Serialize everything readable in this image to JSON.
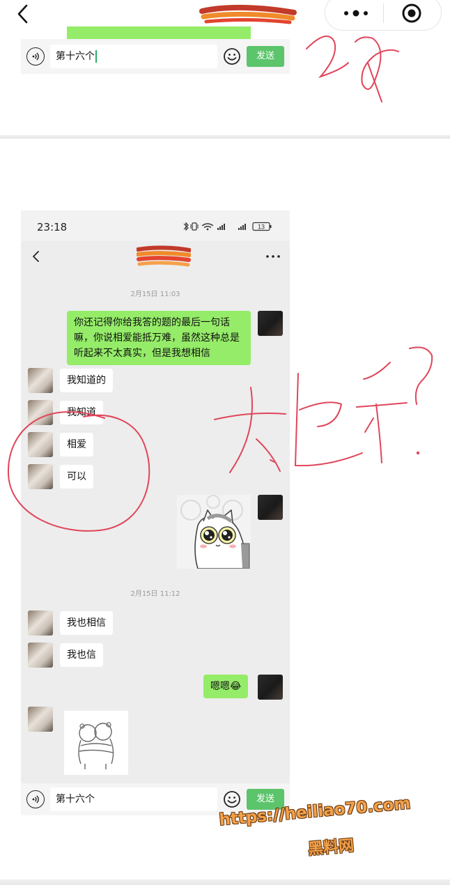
{
  "top_input": {
    "text": "第十六个",
    "send_label": "发送"
  },
  "phone": {
    "status_time": "23:18",
    "battery": "13",
    "messages": [
      {
        "type": "timestamp",
        "text": "2月15日 11:03"
      },
      {
        "type": "text",
        "side": "me",
        "text": "你还记得你给我答的题的最后一句话嘛，你说相爱能抵万难，虽然这种总是听起来不太真实，但是我想相信"
      },
      {
        "type": "text",
        "side": "other",
        "text": "我知道的"
      },
      {
        "type": "text",
        "side": "other",
        "text": "我知道"
      },
      {
        "type": "text",
        "side": "other",
        "text": "相爱"
      },
      {
        "type": "text",
        "side": "other",
        "text": "可以"
      },
      {
        "type": "sticker",
        "side": "me",
        "sticker": "crying-cat-sticker"
      },
      {
        "type": "timestamp",
        "text": "2月15日 11:12"
      },
      {
        "type": "text",
        "side": "other",
        "text": "我也相信"
      },
      {
        "type": "text",
        "side": "other",
        "text": "我也信"
      },
      {
        "type": "text",
        "side": "me",
        "text": "嗯嗯😂"
      },
      {
        "type": "sticker",
        "side": "other",
        "sticker": "hugging-bears-sticker"
      }
    ],
    "input": {
      "text": "第十六个",
      "send_label": "发送"
    }
  },
  "watermark": {
    "url": "https://heiliao70.com",
    "site": "黑料网"
  },
  "colors": {
    "bubble_green": "#95ec69",
    "send_green": "#5cc46b",
    "annotation_red": "#e0455a",
    "watermark_orange": "#f3a14a"
  }
}
